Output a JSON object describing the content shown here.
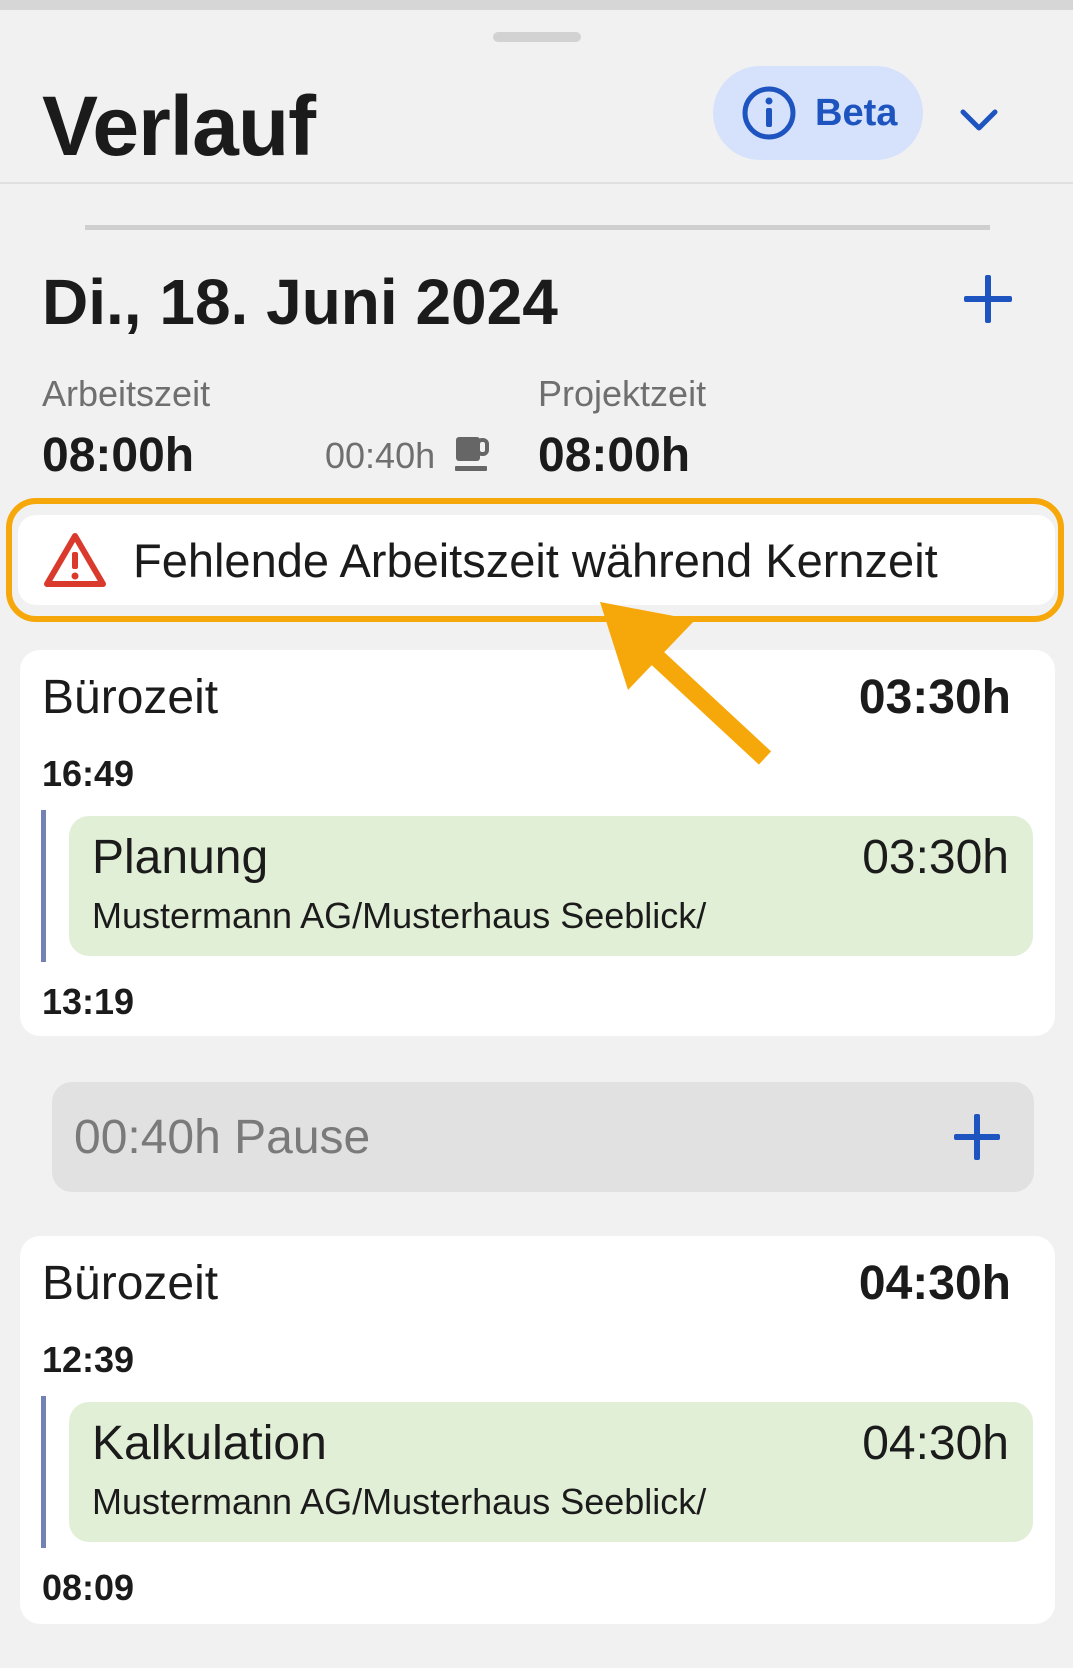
{
  "header": {
    "title": "Verlauf",
    "beta_label": "Beta",
    "info_icon": "info-circle-icon",
    "expand_icon": "chevron-down-icon"
  },
  "day": {
    "date": "Di., 18. Juni 2024",
    "add_icon": "plus-icon",
    "arbeitszeit_label": "Arbeitszeit",
    "arbeitszeit_value": "08:00h",
    "pause_value": "00:40h",
    "pause_icon": "coffee-cup-icon",
    "projektzeit_label": "Projektzeit",
    "projektzeit_value": "08:00h"
  },
  "warning": {
    "text": "Fehlende Arbeitszeit während Kernzeit",
    "icon": "warning-triangle-icon"
  },
  "blocks": [
    {
      "kind": "Bürozeit",
      "duration": "03:30h",
      "end_time": "16:49",
      "start_time": "13:19",
      "entry": {
        "name": "Planung",
        "duration": "03:30h",
        "project": "Mustermann AG/Musterhaus Seeblick/"
      }
    },
    {
      "kind": "Bürozeit",
      "duration": "04:30h",
      "end_time": "12:39",
      "start_time": "08:09",
      "entry": {
        "name": "Kalkulation",
        "duration": "04:30h",
        "project": "Mustermann AG/Musterhaus Seeblick/"
      }
    }
  ],
  "pause": {
    "text": "00:40h Pause",
    "add_icon": "plus-icon"
  },
  "colors": {
    "accent": "#1d54c0",
    "beta_bg": "#d6e2fb",
    "highlight": "#f6a80a",
    "warning": "#d93a2b",
    "entry_bg": "#e2efd7",
    "background": "#f1f1f1"
  }
}
